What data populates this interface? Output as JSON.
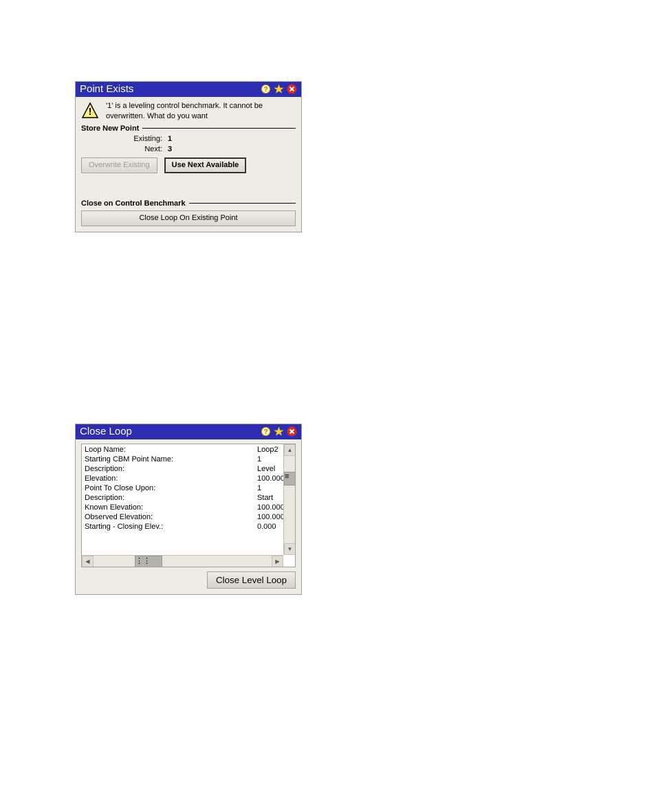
{
  "dialog1": {
    "title": "Point Exists",
    "warning": "'1' is a leveling control benchmark. It cannot be overwritten. What do you want",
    "group_store": "Store New Point",
    "existing_label": "Existing:",
    "existing_value": "1",
    "next_label": "Next:",
    "next_value": "3",
    "btn_overwrite": "Overwrite Existing",
    "btn_use_next": "Use Next Available",
    "group_close": "Close on Control Benchmark",
    "btn_close_loop": "Close Loop On Existing Point"
  },
  "dialog2": {
    "title": "Close Loop",
    "rows": {
      "loop_name": {
        "label": "Loop Name:",
        "value": "Loop2"
      },
      "starting_cbm": {
        "label": "Starting CBM Point Name:",
        "value": "1"
      },
      "description1": {
        "label": "Description:",
        "value": "Level"
      },
      "elevation1": {
        "label": " Elevation:",
        "value": "100.000"
      },
      "pt_close": {
        "label": "Point To Close Upon:",
        "value": "1"
      },
      "description2": {
        "label": " Description:",
        "value": "Start"
      },
      "known_elev": {
        "label": " Known Elevation:",
        "value": "100.000"
      },
      "observed_elev": {
        "label": " Observed Elevation:",
        "value": "100.000"
      },
      "start_closing": {
        "label": "Starting - Closing Elev.:",
        "value": "0.000"
      }
    },
    "btn_close_level": "Close Level Loop"
  },
  "icons": {
    "help": "?",
    "favorite": "★",
    "close": "✕",
    "warning": "!"
  }
}
